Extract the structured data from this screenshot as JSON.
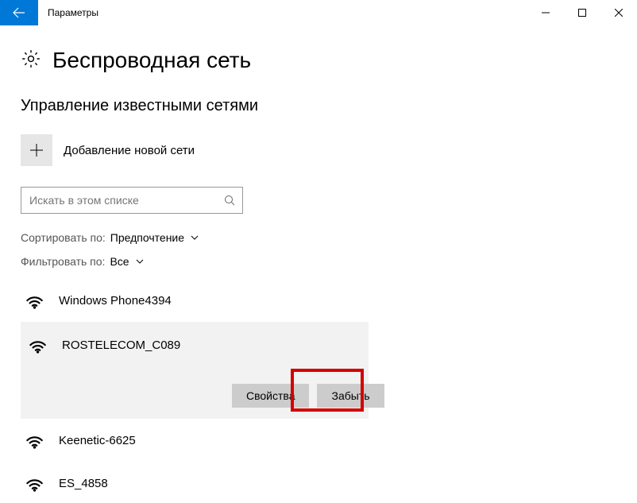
{
  "titlebar": {
    "title": "Параметры"
  },
  "page": {
    "title": "Беспроводная сеть"
  },
  "section": {
    "title": "Управление известными сетями"
  },
  "add": {
    "label": "Добавление новой сети"
  },
  "search": {
    "placeholder": "Искать в этом списке"
  },
  "sort": {
    "label": "Сортировать по:",
    "value": "Предпочтение"
  },
  "filter": {
    "label": "Фильтровать по:",
    "value": "Все"
  },
  "networks": {
    "n0": "Windows Phone4394",
    "n1": "ROSTELECOM_C089",
    "n2": "Keenetic-6625",
    "n3": "ES_4858"
  },
  "buttons": {
    "properties": "Свойства",
    "forget": "Забыть"
  }
}
